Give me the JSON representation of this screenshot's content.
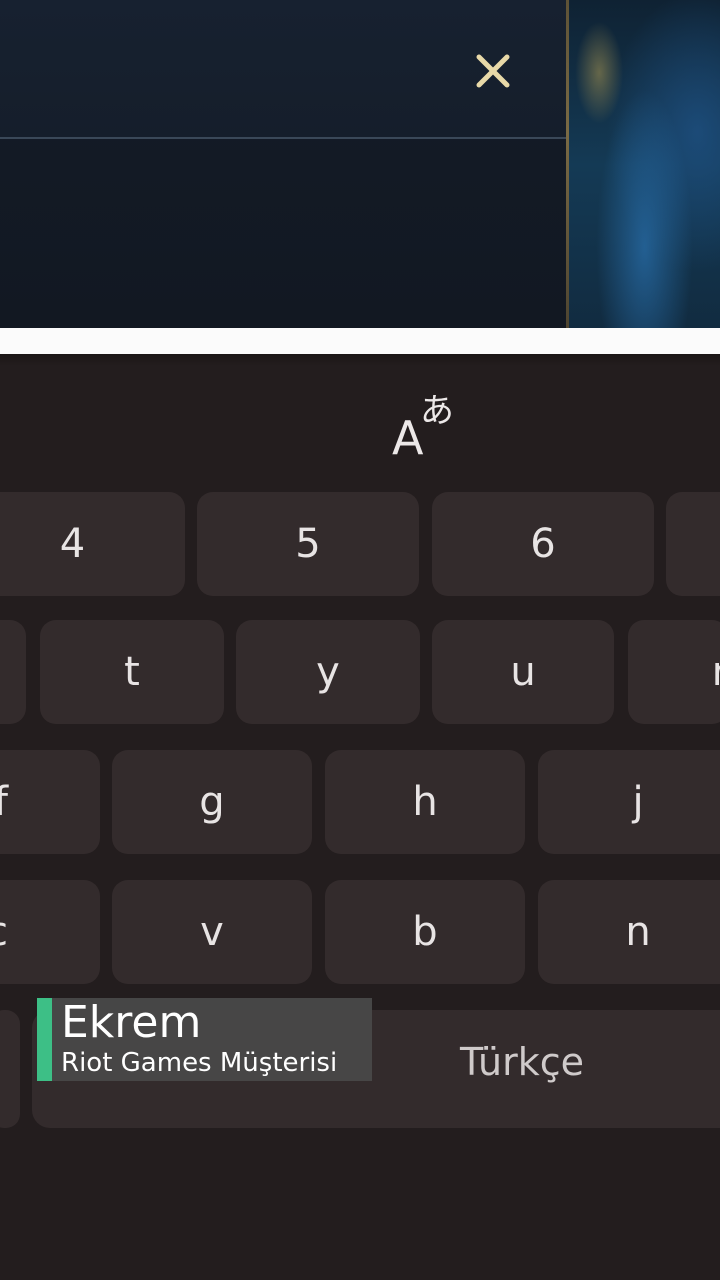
{
  "dialog": {
    "close_icon": "close-icon",
    "accent_color": "#e8d9a8"
  },
  "keyboard": {
    "translate_icon": "translate-icon",
    "rows": [
      [
        "4",
        "5",
        "6",
        ""
      ],
      [
        "",
        "t",
        "y",
        "u",
        "r"
      ],
      [
        "f",
        "g",
        "h",
        "j"
      ],
      [
        "c",
        "v",
        "b",
        "n"
      ]
    ],
    "space_label": "Türkçe",
    "key_color": "#332b2c",
    "background_color": "#231d1e"
  },
  "caption": {
    "name": "Ekrem",
    "role": "Riot Games Müşterisi",
    "accent_color": "#3dbf86"
  }
}
